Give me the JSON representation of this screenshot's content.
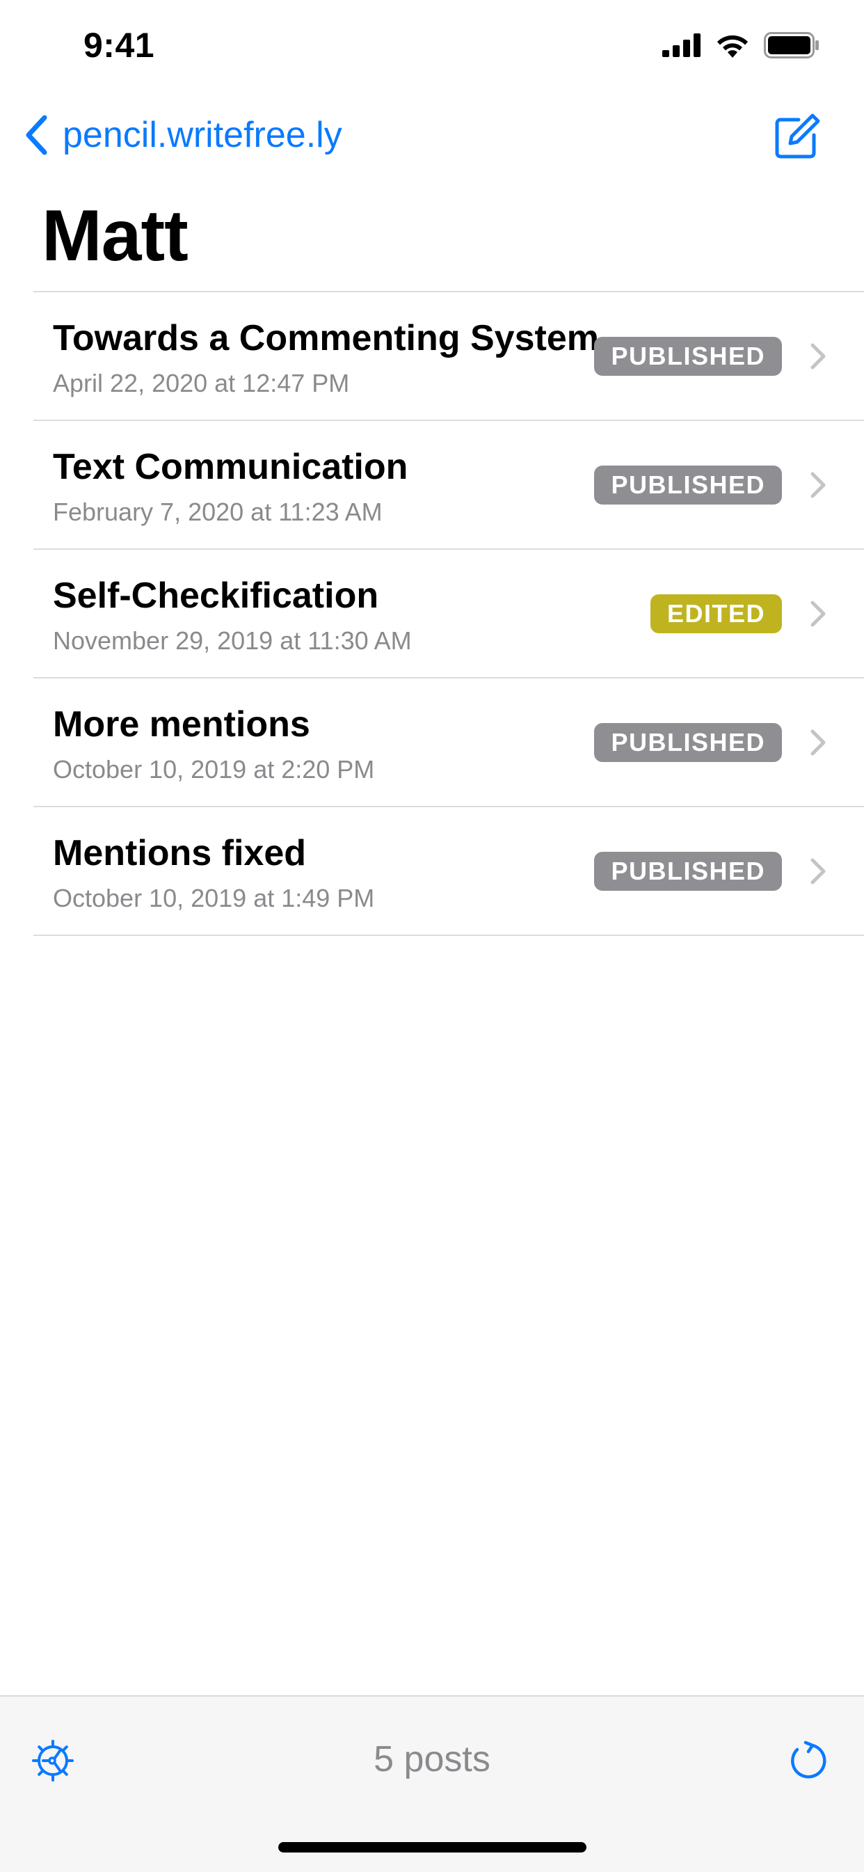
{
  "status_bar": {
    "time": "9:41"
  },
  "nav": {
    "back_label": "pencil.writefree.ly"
  },
  "page_title": "Matt",
  "posts": [
    {
      "title": "Towards a Commenting System",
      "date": "April 22, 2020 at 12:47 PM",
      "status": "PUBLISHED"
    },
    {
      "title": "Text Communication",
      "date": "February 7, 2020 at 11:23 AM",
      "status": "PUBLISHED"
    },
    {
      "title": "Self-Checkification",
      "date": "November 29, 2019 at 11:30 AM",
      "status": "EDITED"
    },
    {
      "title": "More mentions",
      "date": "October 10, 2019 at 2:20 PM",
      "status": "PUBLISHED"
    },
    {
      "title": "Mentions fixed",
      "date": "October 10, 2019 at 1:49 PM",
      "status": "PUBLISHED"
    }
  ],
  "toolbar": {
    "post_count": "5 posts"
  },
  "colors": {
    "accent": "#0a7aff",
    "published_badge": "#8e8e93",
    "edited_badge": "#bfb420",
    "chevron": "#c4c4c7",
    "secondary_text": "#8a8a8e"
  },
  "icons": {
    "back": "chevron-left-icon",
    "compose": "compose-icon",
    "settings": "settings-gear-icon",
    "refresh": "refresh-icon",
    "row_disclosure": "chevron-right-icon"
  }
}
